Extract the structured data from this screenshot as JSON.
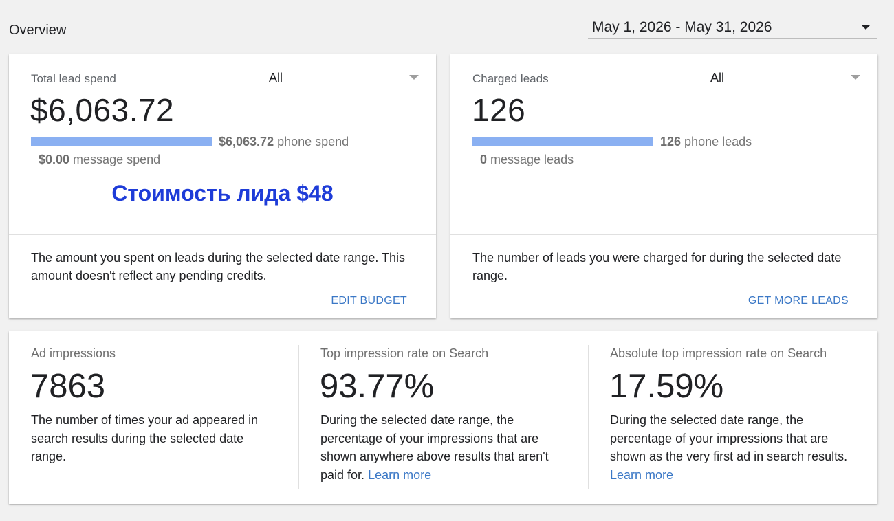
{
  "header": {
    "title": "Overview",
    "date_range": "May 1, 2026 - May 31, 2026"
  },
  "lead_spend_card": {
    "label": "Total lead spend",
    "filter_value": "All",
    "value": "$6,063.72",
    "phone_amount": "$6,063.72",
    "phone_suffix": " phone spend",
    "phone_fraction": 1.0,
    "message_amount": "$0.00",
    "message_suffix": " message spend",
    "annotation": "Стоимость лида $48",
    "description": "The amount you spent on leads during the selected date range. This amount doesn't reflect any pending credits.",
    "action": "EDIT BUDGET"
  },
  "charged_leads_card": {
    "label": "Charged leads",
    "filter_value": "All",
    "value": "126",
    "phone_amount": "126",
    "phone_suffix": " phone leads",
    "phone_fraction": 1.0,
    "message_amount": "0",
    "message_suffix": " message leads",
    "description": "The number of leads you were charged for during the selected date range.",
    "action": "GET MORE LEADS"
  },
  "stats": {
    "impressions": {
      "label": "Ad impressions",
      "value": "7863",
      "description": "The number of times your ad appeared in search results during the selected date range."
    },
    "top_rate": {
      "label": "Top impression rate on Search",
      "value": "93.77%",
      "description": "During the selected date range, the percentage of your impressions that are shown anywhere above results that aren't paid for.",
      "link": "Learn more"
    },
    "abs_top_rate": {
      "label": "Absolute top impression rate on Search",
      "value": "17.59%",
      "description": "During the selected date range, the percentage of your impressions that are shown as the very first ad in search results.",
      "link": "Learn more"
    }
  },
  "colors": {
    "bar": "#8ab0f2",
    "link": "#3b78c6",
    "annotation": "#1e3cd8",
    "background": "#f1f1f1"
  }
}
